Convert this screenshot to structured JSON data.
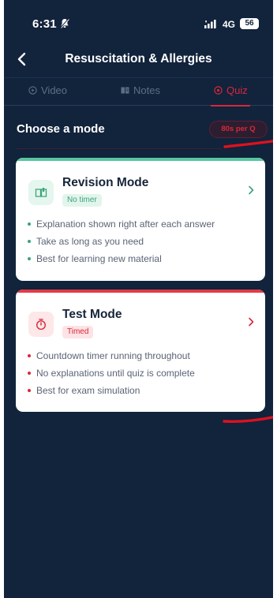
{
  "status_bar": {
    "time": "6:31",
    "network": "4G",
    "battery": "56",
    "icons": [
      "bell-muted-icon",
      "signal-icon"
    ]
  },
  "header": {
    "title": "Resuscitation & Allergies",
    "back_icon": "chevron-left-icon"
  },
  "tabs": [
    {
      "label": "Video",
      "icon": "play-circle-icon",
      "active": false
    },
    {
      "label": "Notes",
      "icon": "notes-icon",
      "active": false
    },
    {
      "label": "Quiz",
      "icon": "quiz-icon",
      "active": true
    }
  ],
  "mode_section": {
    "heading": "Choose a mode",
    "badge": "80s per Q"
  },
  "modes": [
    {
      "title": "Revision Mode",
      "tag": "No timer",
      "icon": "book-icon",
      "accent_color": "#58c7a0",
      "features": [
        "Explanation shown right after each answer",
        "Take as long as you need",
        "Best for learning new material"
      ]
    },
    {
      "title": "Test Mode",
      "tag": "Timed",
      "icon": "stopwatch-icon",
      "accent_color": "#e23a47",
      "features": [
        "Countdown timer running throughout",
        "No explanations until quiz is complete",
        "Best for exam simulation"
      ]
    }
  ],
  "colors": {
    "background": "#12233c",
    "accent_red": "#d9273a",
    "accent_green": "#3aa27c"
  }
}
